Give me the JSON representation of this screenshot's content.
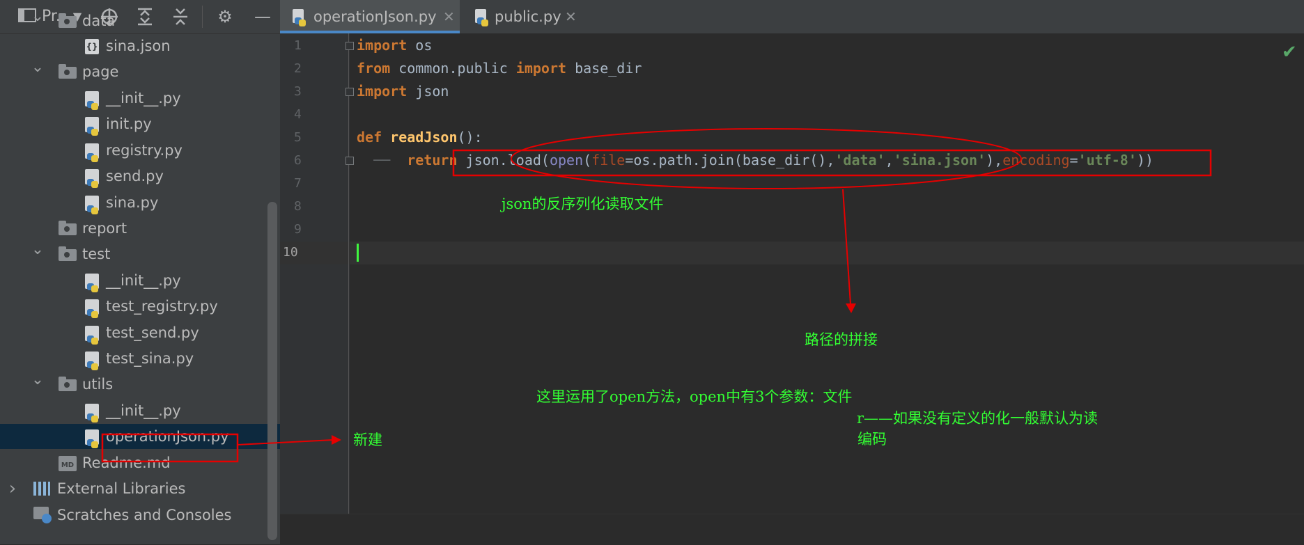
{
  "toolbar": {
    "project_label": "Pr...",
    "icons": [
      "project-view-icon",
      "dropdown-icon",
      "locate-icon",
      "expand-all-icon",
      "collapse-all-icon",
      "gear-icon",
      "minimize-icon"
    ]
  },
  "tree": [
    {
      "label": "data",
      "type": "folder",
      "expanded": true
    },
    {
      "label": "sina.json",
      "type": "json"
    },
    {
      "label": "page",
      "type": "folder",
      "expanded": true
    },
    {
      "label": "__init__.py",
      "type": "py"
    },
    {
      "label": "init.py",
      "type": "py"
    },
    {
      "label": "registry.py",
      "type": "py"
    },
    {
      "label": "send.py",
      "type": "py"
    },
    {
      "label": "sina.py",
      "type": "py"
    },
    {
      "label": "report",
      "type": "folder"
    },
    {
      "label": "test",
      "type": "folder",
      "expanded": true
    },
    {
      "label": "__init__.py",
      "type": "py"
    },
    {
      "label": "test_registry.py",
      "type": "py"
    },
    {
      "label": "test_send.py",
      "type": "py"
    },
    {
      "label": "test_sina.py",
      "type": "py"
    },
    {
      "label": "utils",
      "type": "folder",
      "expanded": true
    },
    {
      "label": "__init__.py",
      "type": "py"
    },
    {
      "label": "operationJson.py",
      "type": "py",
      "selected": true
    },
    {
      "label": "Readme.md",
      "type": "md"
    },
    {
      "label": "External Libraries",
      "type": "lib",
      "collapsed": true
    },
    {
      "label": "Scratches and Consoles",
      "type": "scratch"
    }
  ],
  "tabs": [
    {
      "label": "operationJson.py",
      "active": true
    },
    {
      "label": "public.py",
      "active": false
    }
  ],
  "editor": {
    "line_numbers": [
      "1",
      "2",
      "3",
      "4",
      "5",
      "6",
      "7",
      "8",
      "9",
      "10"
    ],
    "current_line": "10",
    "lines": {
      "l1": {
        "kw": "import",
        "rest": " os"
      },
      "l2": {
        "kw1": "from",
        "mid": " common.public ",
        "kw2": "import",
        "rest": " base_dir"
      },
      "l3": {
        "kw": "import",
        "rest": " json"
      },
      "l5": {
        "kw": "def",
        "fn": " readJson",
        "rest": "():"
      },
      "l6": {
        "kw": "return",
        "a": " json.load(",
        "open": "open",
        "b": "(",
        "p1": "file",
        "c": "=os.path.join(base_dir(),",
        "s1": "'data'",
        "d": ",",
        "s2": "'sina.json'",
        "e": "),",
        "p2": "encoding",
        "f": "=",
        "s3": "'utf-8'",
        "g": "))"
      }
    }
  },
  "annotations": {
    "deserialize": "json的反序列化读取文件",
    "path_join": "路径的拼接",
    "open_note": "这里运用了open方法，open中有3个参数：文件",
    "r_note": "r——如果没有定义的化一般默认为读",
    "encoding_note": "编码",
    "new_note": "新建"
  },
  "colors": {
    "annotation_text": "#33ff33",
    "annotation_mark": "#e60000",
    "keyword": "#cc7832",
    "string": "#6a8759",
    "selection": "#0d293e",
    "caret": "#3ff53f"
  }
}
